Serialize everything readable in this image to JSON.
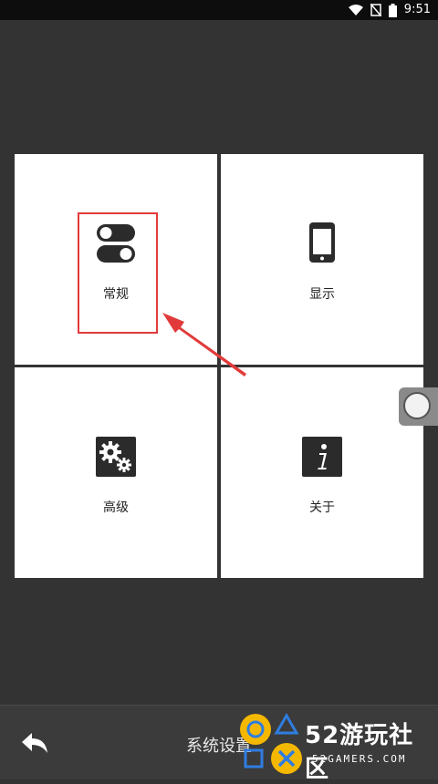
{
  "status_bar": {
    "time": "9:51",
    "icons": [
      "wifi-icon",
      "no-sim-icon",
      "battery-icon"
    ]
  },
  "tiles": [
    {
      "label": "常规",
      "icon": "toggle-switches-icon"
    },
    {
      "label": "显示",
      "icon": "phone-icon"
    },
    {
      "label": "高级",
      "icon": "gears-icon"
    },
    {
      "label": "关于",
      "icon": "info-icon"
    }
  ],
  "bottom_bar": {
    "title": "系统设置",
    "back_icon": "back-arrow-icon"
  },
  "watermark": {
    "brand": "52游玩社区",
    "sub": "52GAMERS.COM"
  },
  "colors": {
    "background": "#333333",
    "tile": "#ffffff",
    "highlight": "#e23a3a",
    "watermark_yellow": "#f5b800",
    "watermark_blue": "#2f7de1"
  }
}
